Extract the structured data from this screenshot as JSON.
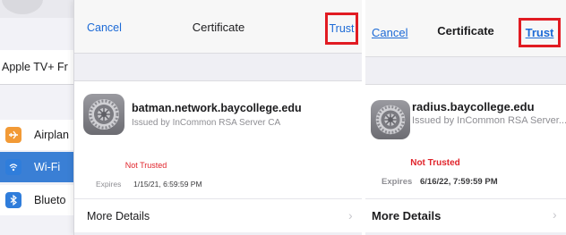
{
  "sidebar": {
    "text_item": "Apple TV+ Fr",
    "items": [
      {
        "label": "Airplan",
        "icon": "airplane-icon",
        "icon_bg": "#f29a36",
        "selected": false
      },
      {
        "label": "Wi-Fi",
        "icon": "wifi-icon",
        "icon_bg": "#2f7ddb",
        "selected": true
      },
      {
        "label": "Blueto",
        "icon": "bluetooth-icon",
        "icon_bg": "#2f7ddb",
        "selected": false
      }
    ]
  },
  "left_modal": {
    "cancel_label": "Cancel",
    "title": "Certificate",
    "trust_label": "Trust",
    "cert_icon": "settings-gear-icon",
    "cert_name": "batman.network.baycollege.edu",
    "cert_issuer": "Issued by InCommon RSA Server CA",
    "status": "Not Trusted",
    "expires_label": "Expires",
    "expires_value": "1/15/21, 6:59:59 PM",
    "more_details_label": "More Details",
    "chevron": "›"
  },
  "right_modal": {
    "cancel_label": "Cancel",
    "title": "Certificate",
    "trust_label": "Trust",
    "cert_icon": "settings-gear-icon",
    "cert_name": "radius.baycollege.edu",
    "cert_issuer": "Issued by InCommon RSA Server...",
    "status": "Not Trusted",
    "expires_label": "Expires",
    "expires_value": "6/16/22, 7:59:59 PM",
    "more_details_label": "More Details",
    "chevron": "›"
  },
  "colors": {
    "accent_blue": "#1c6ad6",
    "highlight_red": "#e11b22",
    "warning_red": "#e0242b",
    "selected_row": "#3a7fd5"
  }
}
